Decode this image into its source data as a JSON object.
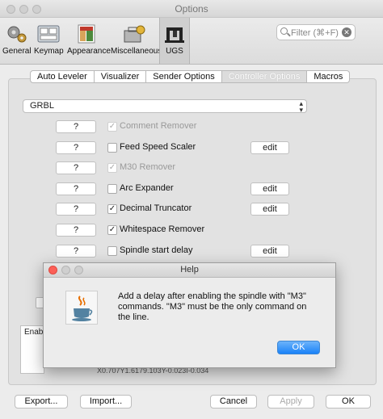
{
  "window": {
    "title": "Options"
  },
  "toolbar": {
    "items": [
      {
        "label": "General",
        "icon": "gears-icon"
      },
      {
        "label": "Keymap",
        "icon": "keyboard-icon"
      },
      {
        "label": "Appearance",
        "icon": "palette-icon"
      },
      {
        "label": "Miscellaneous",
        "icon": "toolbox-icon"
      },
      {
        "label": "UGS",
        "icon": "ugs-machine-icon",
        "selected": true
      }
    ],
    "filter_placeholder": "Filter (⌘+F)"
  },
  "tabs": [
    {
      "label": "Auto Leveler"
    },
    {
      "label": "Visualizer"
    },
    {
      "label": "Sender Options"
    },
    {
      "label": "Controller Options",
      "selected": true
    },
    {
      "label": "Macros"
    }
  ],
  "firmware_select": {
    "value": "GRBL"
  },
  "processors": [
    {
      "help": "?",
      "label": "Comment Remover",
      "checked": true,
      "enabled": false,
      "edit": null
    },
    {
      "help": "?",
      "label": "Feed Speed Scaler",
      "checked": false,
      "enabled": true,
      "edit": "edit"
    },
    {
      "help": "?",
      "label": "M30 Remover",
      "checked": true,
      "enabled": false,
      "edit": null
    },
    {
      "help": "?",
      "label": "Arc Expander",
      "checked": false,
      "enabled": true,
      "edit": "edit"
    },
    {
      "help": "?",
      "label": "Decimal Truncator",
      "checked": true,
      "enabled": true,
      "edit": "edit"
    },
    {
      "help": "?",
      "label": "Whitespace Remover",
      "checked": true,
      "enabled": true,
      "edit": null
    },
    {
      "help": "?",
      "label": "Spindle start delay",
      "checked": false,
      "enabled": true,
      "edit": "edit"
    }
  ],
  "behind": {
    "enabled_header": "Enabl",
    "table_tail": "X0.707Y1.6179.103Y-0.023I-0.034"
  },
  "bottom": {
    "export": "Export...",
    "import": "Import...",
    "cancel": "Cancel",
    "apply": "Apply",
    "ok": "OK"
  },
  "help_dialog": {
    "title": "Help",
    "icon": "java-coffee-icon",
    "message_lines": [
      "Add a delay after enabling the spindle with \"M3\"",
      "commands. \"M3\" must be the only command on",
      "the line."
    ],
    "ok": "OK"
  },
  "colors": {
    "accent": "#1a82f8",
    "close_red": "#fc5f57",
    "min_yellow": "#c9c9c9"
  }
}
